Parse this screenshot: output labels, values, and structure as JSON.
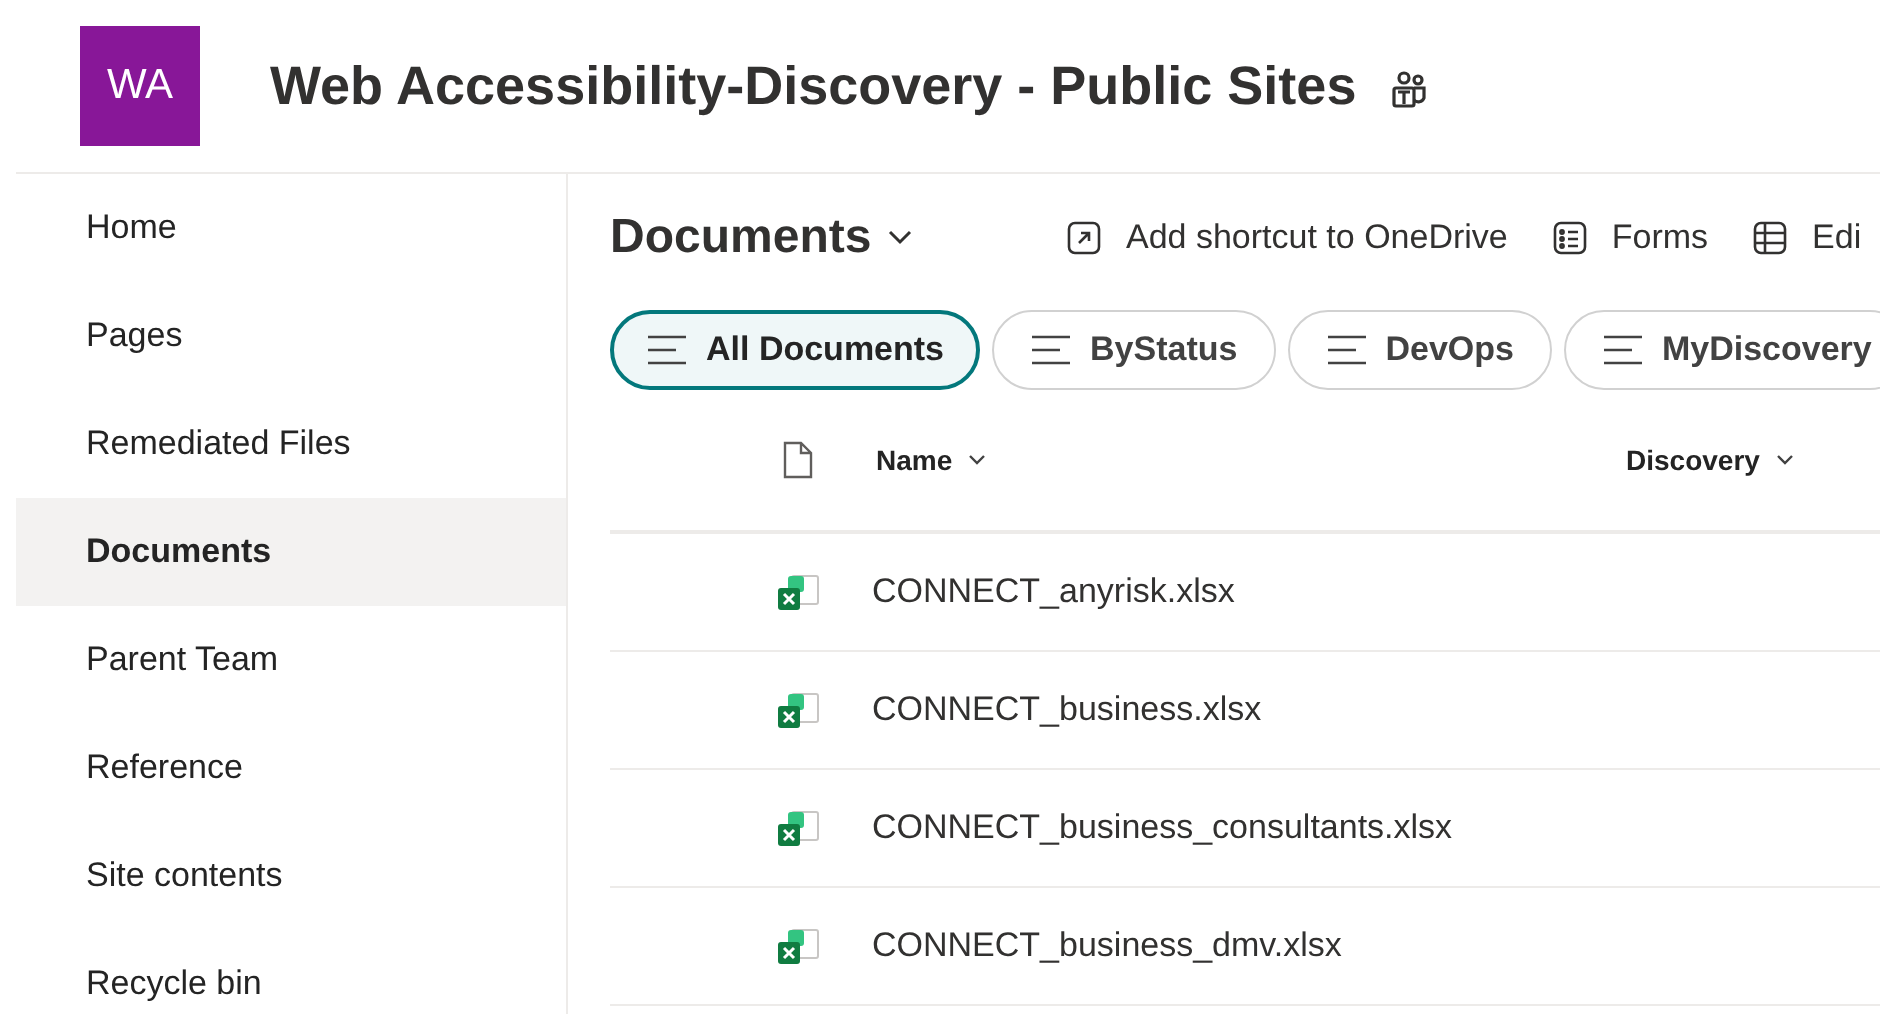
{
  "site": {
    "logo": "WA",
    "title": "Web Accessibility-Discovery - Public Sites"
  },
  "nav": [
    {
      "label": "Home",
      "selected": false
    },
    {
      "label": "Pages",
      "selected": false
    },
    {
      "label": "Remediated Files",
      "selected": false
    },
    {
      "label": "Documents",
      "selected": true
    },
    {
      "label": "Parent Team",
      "selected": false
    },
    {
      "label": "Reference",
      "selected": false
    },
    {
      "label": "Site contents",
      "selected": false
    },
    {
      "label": "Recycle bin",
      "selected": false
    }
  ],
  "library": {
    "title": "Documents"
  },
  "commands": [
    {
      "kind": "shortcut",
      "label": "Add shortcut to OneDrive"
    },
    {
      "kind": "forms",
      "label": "Forms"
    },
    {
      "kind": "grid",
      "label": "Edi"
    }
  ],
  "views": [
    {
      "label": "All Documents",
      "selected": true
    },
    {
      "label": "ByStatus",
      "selected": false
    },
    {
      "label": "DevOps",
      "selected": false
    },
    {
      "label": "MyDiscovery",
      "selected": false
    }
  ],
  "table": {
    "columns": [
      "Name",
      "Discovery"
    ],
    "rows": [
      {
        "name": "CONNECT_anyrisk.xlsx"
      },
      {
        "name": "CONNECT_business.xlsx"
      },
      {
        "name": "CONNECT_business_consultants.xlsx"
      },
      {
        "name": "CONNECT_business_dmv.xlsx"
      }
    ]
  }
}
